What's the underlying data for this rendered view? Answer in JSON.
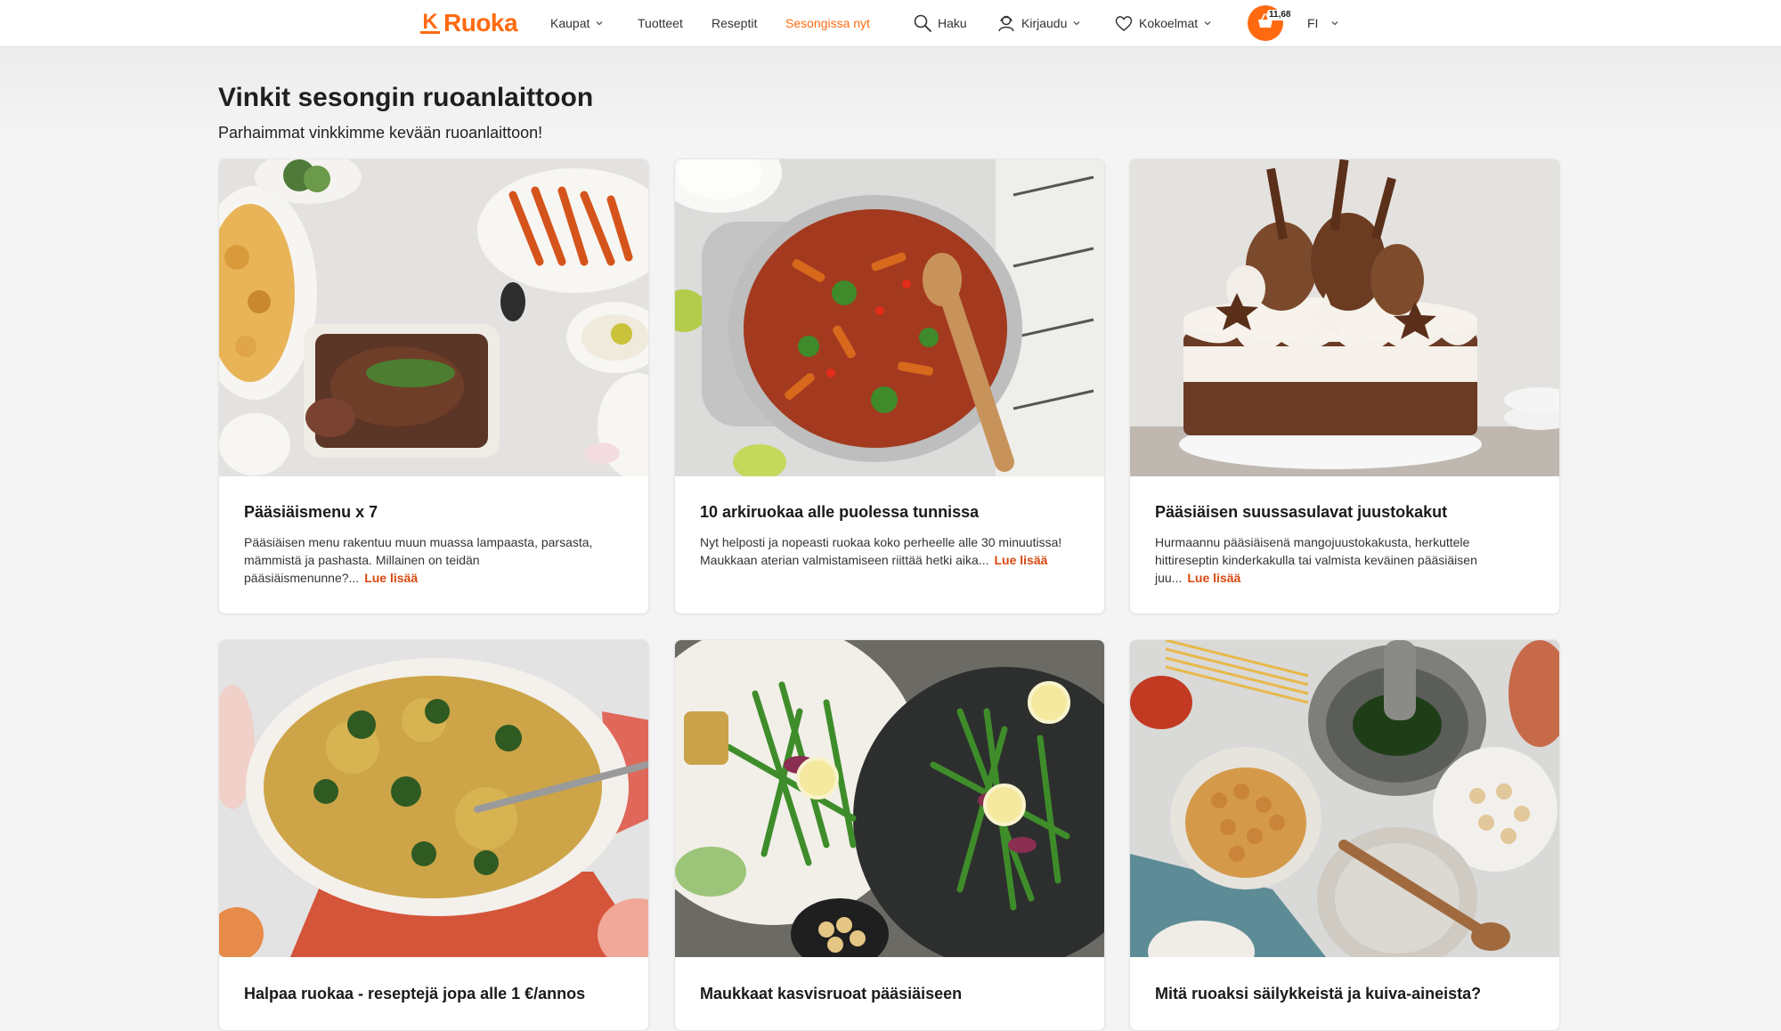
{
  "header": {
    "logo_text": "Ruoka",
    "logo_letter": "K",
    "nav": [
      {
        "label": "Kaupat"
      },
      {
        "label": "Tuotteet"
      },
      {
        "label": "Reseptit"
      },
      {
        "label": "Sesongissa nyt"
      }
    ],
    "search_label": "Haku",
    "login_label": "Kirjaudu",
    "collections_label": "Kokoelmat",
    "cart_total": "11,68",
    "language": "FI",
    "accent_color": "#ff6a10"
  },
  "main": {
    "title": "Vinkit sesongin ruoanlaittoon",
    "subtitle": "Parhaimmat vinkkimme kevään ruoanlaittoon!",
    "read_more_label": "Lue lisää",
    "cards": [
      {
        "title": "Pääsiäismenu x 7",
        "text": "Pääsiäisen menu rakentuu muun muassa lampaasta, parsasta, mämmistä ja pashasta. Millainen on teidän pääsiäismenunne?...",
        "image": "easter-lamb-dinner"
      },
      {
        "title": "10 arkiruokaa alle puolessa tunnissa",
        "text": "Nyt helposti ja nopeasti ruokaa koko perheelle alle 30 minuutissa! Maukkaan aterian valmistamiseen riittää hetki aika...",
        "image": "pasta-pot"
      },
      {
        "title": "Pääsiäisen suussasulavat juustokakut",
        "text": "Hurmaannu pääsiäisenä mangojuustokakusta, herkuttele hittireseptin kinderkakulla tai valmista keväinen pääsiäisen juu...",
        "image": "chocolate-egg-cake"
      },
      {
        "title": "Halpaa ruokaa - reseptejä jopa alle 1 €/annos",
        "text": "",
        "image": "rice-casserole"
      },
      {
        "title": "Maukkaat kasvisruoat pääsiäiseen",
        "text": "",
        "image": "green-bean-salad"
      },
      {
        "title": "Mitä ruoaksi säilykkeistä ja kuiva-aineista?",
        "text": "",
        "image": "chickpeas-pantry"
      }
    ]
  }
}
